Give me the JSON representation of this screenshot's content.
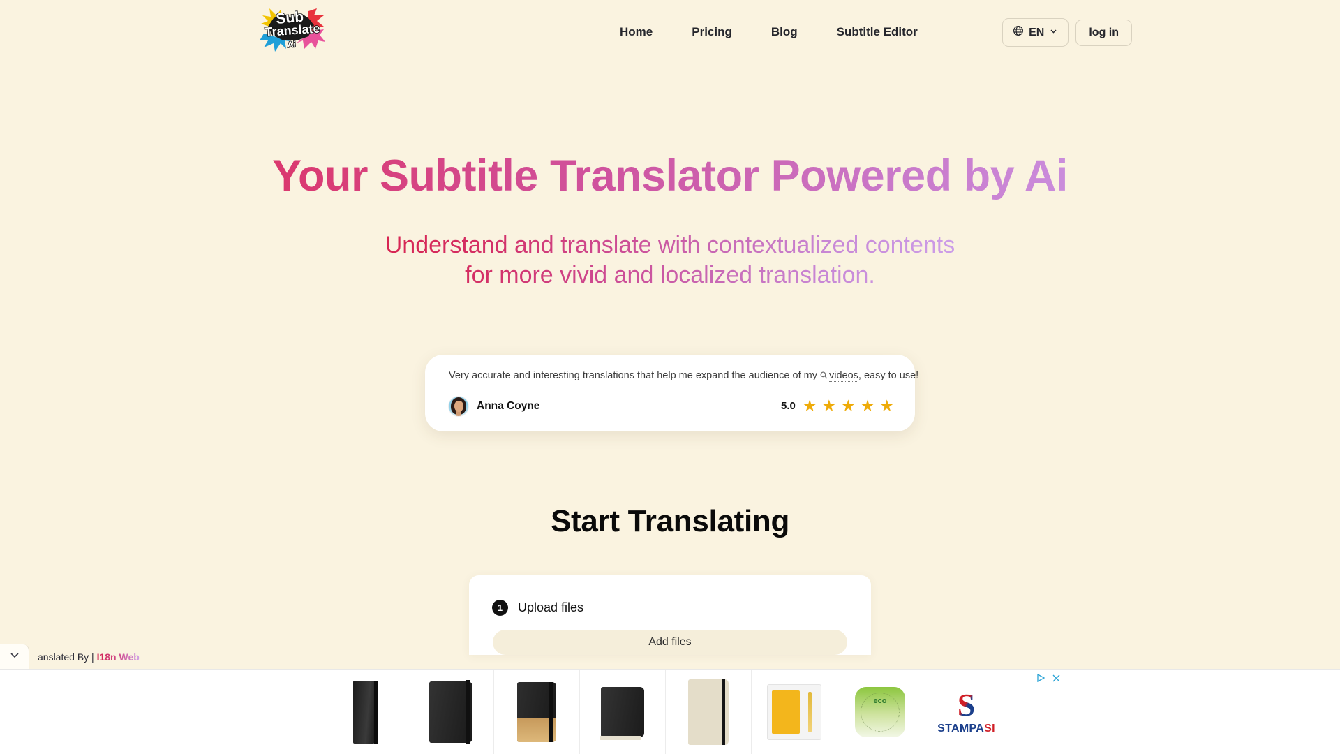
{
  "header": {
    "logo_alt": "Sub Translate Ai",
    "logo_lines": [
      "Sub",
      "Translate",
      "Ai"
    ],
    "nav": [
      {
        "label": "Home"
      },
      {
        "label": "Pricing"
      },
      {
        "label": "Blog"
      },
      {
        "label": "Subtitle Editor"
      }
    ],
    "language": {
      "code": "EN",
      "icon": "globe-icon",
      "chevron": "chevron-down-icon"
    },
    "login_label": "log in"
  },
  "hero": {
    "title": "Your Subtitle Translator Powered by Ai",
    "subtitle": "Understand and translate with contextualized contents for more vivid and localized translation.",
    "gradient_start": "#e02050",
    "gradient_end": "#cfa3ef"
  },
  "testimonial": {
    "quote_before": "Very accurate and interesting translations that help me expand the audience of my",
    "quote_link": "videos",
    "quote_after": ", easy to use!",
    "author": "Anna Coyne",
    "rating_value": "5.0",
    "stars": 5,
    "star_color": "#eeab09"
  },
  "start": {
    "heading": "Start Translating",
    "step_number": "1",
    "step_label": "Upload files",
    "add_files_label": "Add files"
  },
  "translate_bar": {
    "text_prefix": "anslated By | ",
    "brand": "I18n Web",
    "toggle_icon": "chevron-down-icon"
  },
  "ad": {
    "brand_mark": "S",
    "brand_part_blue": "STAMPA",
    "brand_part_red": "SI",
    "eco_text": "eco",
    "controls": [
      "ad-info-icon",
      "close-icon"
    ]
  },
  "colors": {
    "page_background": "#faf3e0",
    "card_background": "#ffffff",
    "text_primary": "#111111",
    "button_fill": "#f5eeda"
  }
}
